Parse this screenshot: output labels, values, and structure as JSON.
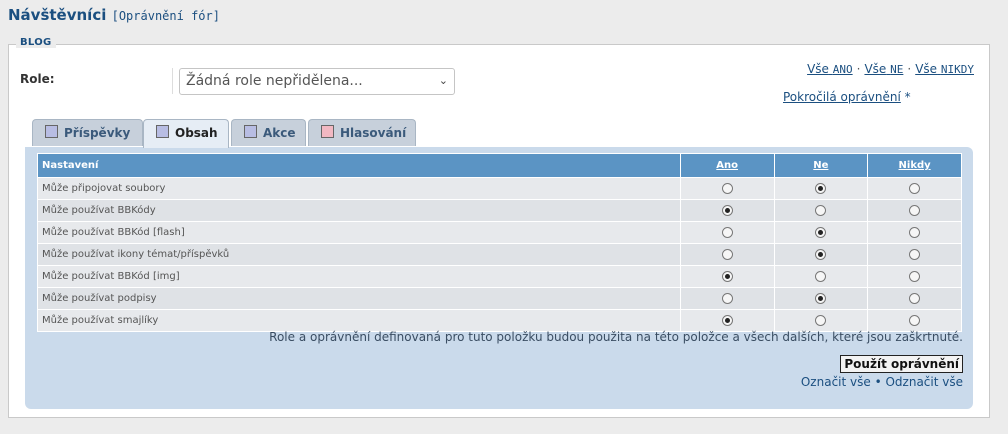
{
  "header": {
    "title": "Návštěvníci",
    "subtitle": "[Oprávnění fór]"
  },
  "panel": {
    "legend": "BLOG"
  },
  "role": {
    "label": "Role:",
    "selected": "Žádná role nepřidělena..."
  },
  "toplinks": {
    "all_yes_prefix": "Vše",
    "all_yes": "ANO",
    "all_no_prefix": "Vše",
    "all_no": "NE",
    "all_never_prefix": "Vše",
    "all_never": "NIKDY",
    "advanced": "Pokročilá oprávnění",
    "advanced_suffix": "*"
  },
  "tabs": [
    {
      "label": "Příspěvky",
      "color": "#b8bde3"
    },
    {
      "label": "Obsah",
      "color": "#b8bde3"
    },
    {
      "label": "Akce",
      "color": "#b8bde3"
    },
    {
      "label": "Hlasování",
      "color": "#f2b8c2"
    }
  ],
  "table": {
    "columns": [
      "Nastavení",
      "Ano",
      "Ne",
      "Nikdy"
    ],
    "rows": [
      {
        "label": "Může připojovat soubory",
        "value": "Ne"
      },
      {
        "label": "Může používat BBKódy",
        "value": "Ano"
      },
      {
        "label": "Může používat BBKód [flash]",
        "value": "Ne"
      },
      {
        "label": "Může používat ikony témat/příspěvků",
        "value": "Ne"
      },
      {
        "label": "Může používat BBKód [img]",
        "value": "Ano"
      },
      {
        "label": "Může používat podpisy",
        "value": "Ne"
      },
      {
        "label": "Může používat smajlíky",
        "value": "Ano"
      }
    ]
  },
  "note": "Role a oprávnění definovaná pro tuto položku budou použita na této položce a všech dalších, které jsou zaškrtnuté.",
  "apply_button": "Použít oprávnění",
  "mark_all": "Označit vše",
  "unmark_all": "Odznačit vše",
  "bullet": "•"
}
